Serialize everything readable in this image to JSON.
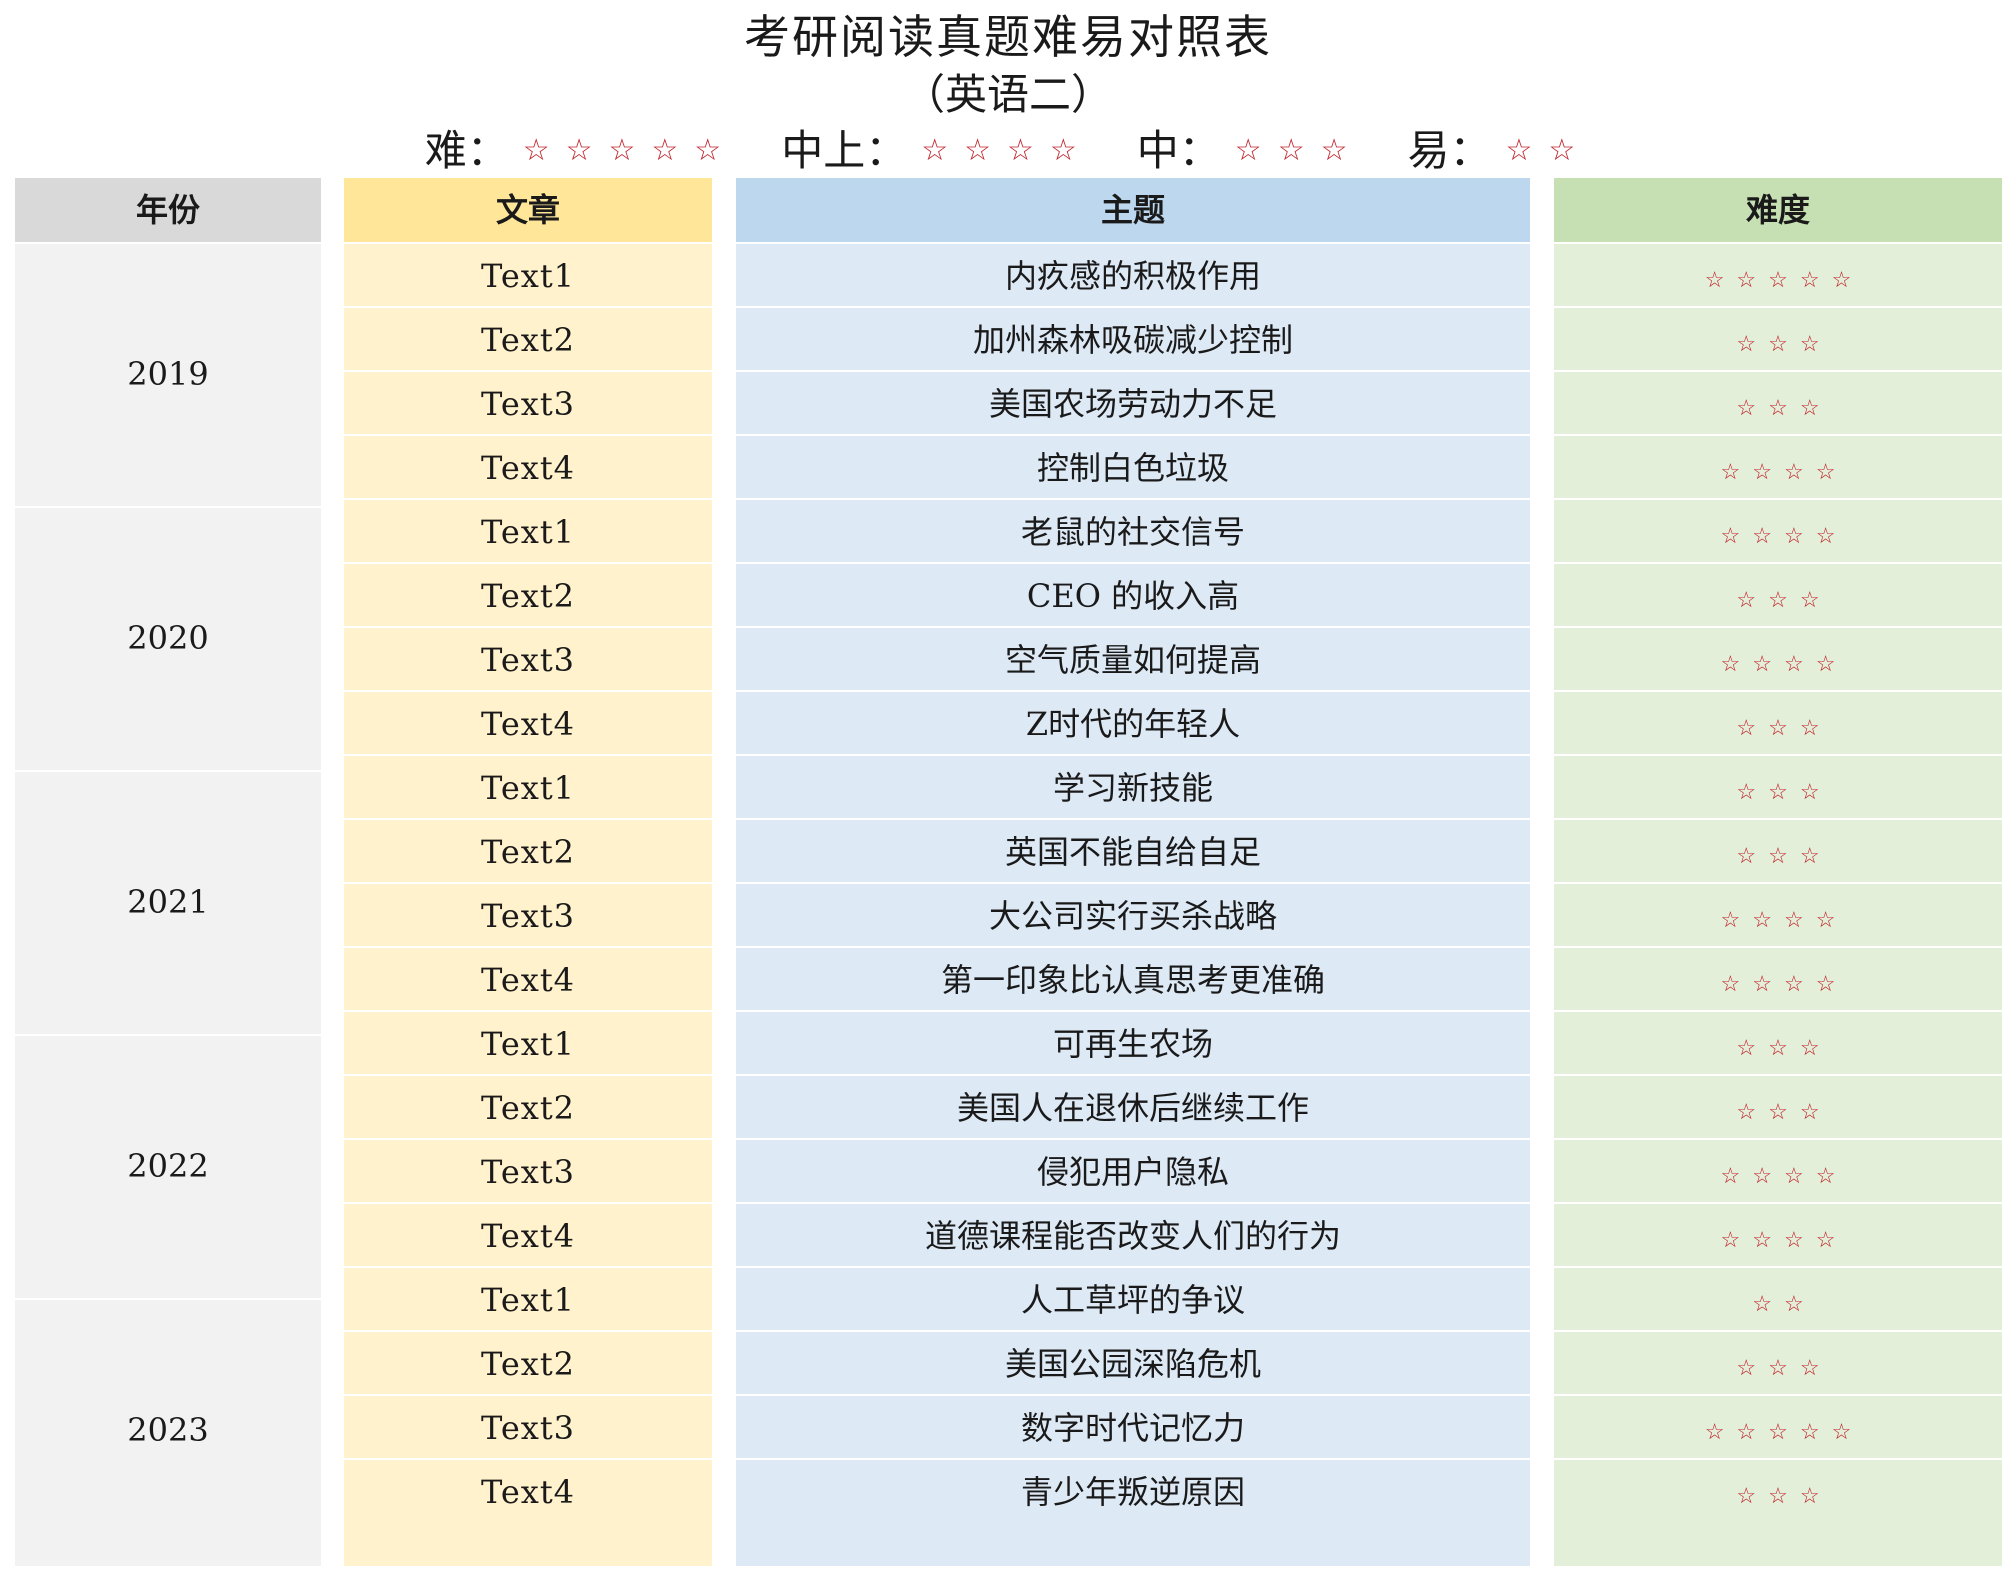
{
  "title": "考研阅读真题难易对照表",
  "subtitle": "（英语二）",
  "legend": [
    {
      "label": "难：",
      "stars": "☆☆☆☆☆"
    },
    {
      "label": "中上：",
      "stars": "☆☆☆☆"
    },
    {
      "label": "中：",
      "stars": "☆☆☆"
    },
    {
      "label": "易：",
      "stars": "☆☆"
    }
  ],
  "headers": {
    "year": "年份",
    "text": "文章",
    "topic": "主题",
    "difficulty": "难度"
  },
  "years": [
    "2019",
    "2020",
    "2021",
    "2022",
    "2023"
  ],
  "rows": [
    {
      "text": "Text1",
      "topic": "内疚感的积极作用",
      "difficulty": "☆☆☆☆☆"
    },
    {
      "text": "Text2",
      "topic": "加州森林吸碳减少控制",
      "difficulty": "☆☆☆"
    },
    {
      "text": "Text3",
      "topic": "美国农场劳动力不足",
      "difficulty": "☆☆☆"
    },
    {
      "text": "Text4",
      "topic": "控制白色垃圾",
      "difficulty": "☆☆☆☆"
    },
    {
      "text": "Text1",
      "topic": "老鼠的社交信号",
      "difficulty": "☆☆☆☆"
    },
    {
      "text": "Text2",
      "topic": "CEO 的收入高",
      "difficulty": "☆☆☆"
    },
    {
      "text": "Text3",
      "topic": "空气质量如何提高",
      "difficulty": "☆☆☆☆"
    },
    {
      "text": "Text4",
      "topic": "Z时代的年轻人",
      "difficulty": "☆☆☆"
    },
    {
      "text": "Text1",
      "topic": "学习新技能",
      "difficulty": "☆☆☆"
    },
    {
      "text": "Text2",
      "topic": "英国不能自给自足",
      "difficulty": "☆☆☆"
    },
    {
      "text": "Text3",
      "topic": "大公司实行买杀战略",
      "difficulty": "☆☆☆☆"
    },
    {
      "text": "Text4",
      "topic": "第一印象比认真思考更准确",
      "difficulty": "☆☆☆☆"
    },
    {
      "text": "Text1",
      "topic": "可再生农场",
      "difficulty": "☆☆☆"
    },
    {
      "text": "Text2",
      "topic": "美国人在退休后继续工作",
      "difficulty": "☆☆☆"
    },
    {
      "text": "Text3",
      "topic": "侵犯用户隐私",
      "difficulty": "☆☆☆☆"
    },
    {
      "text": "Text4",
      "topic": "道德课程能否改变人们的行为",
      "difficulty": "☆☆☆☆"
    },
    {
      "text": "Text1",
      "topic": "人工草坪的争议",
      "difficulty": "☆☆"
    },
    {
      "text": "Text2",
      "topic": "美国公园深陷危机",
      "difficulty": "☆☆☆"
    },
    {
      "text": "Text3",
      "topic": "数字时代记忆力",
      "difficulty": "☆☆☆☆☆"
    },
    {
      "text": "Text4",
      "topic": "青少年叛逆原因",
      "difficulty": "☆☆☆"
    }
  ],
  "colors": {
    "star": "#c0262d",
    "year_col": "#f2f2f2",
    "text_col": "#fff2cc",
    "topic_col": "#dde9f5",
    "difficulty_col": "#e4efda"
  }
}
